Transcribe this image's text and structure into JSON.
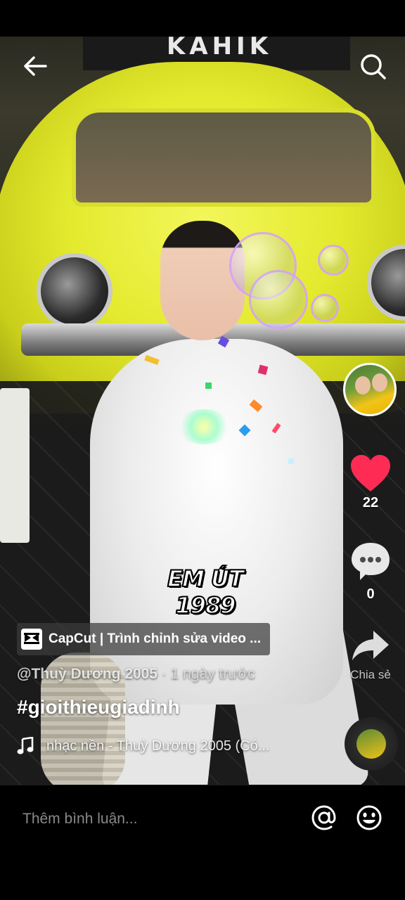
{
  "video": {
    "background_sign_text": "KAHIK",
    "sticker_line1": "EM ÚT",
    "sticker_line2": "1989"
  },
  "actions": {
    "like_count": "22",
    "comment_count": "0",
    "share_label": "Chia sẻ"
  },
  "capcut": {
    "label": "CapCut | Trình chỉnh sửa video ..."
  },
  "post": {
    "author": "@Thuỳ Dương 2005",
    "separator": " · ",
    "time": "1 ngày trước",
    "hashtag": "#gioithieugiadinh",
    "music": "nhạc nền - Thuỳ Dương 2005 (Có..."
  },
  "comment_bar": {
    "placeholder": "Thêm bình luận..."
  },
  "colors": {
    "like_red": "#fe2c55",
    "background": "#000000"
  },
  "icons": [
    "back-arrow-icon",
    "search-icon",
    "heart-icon",
    "comment-icon",
    "share-arrow-icon",
    "music-note-icon",
    "at-icon",
    "emoji-icon"
  ]
}
